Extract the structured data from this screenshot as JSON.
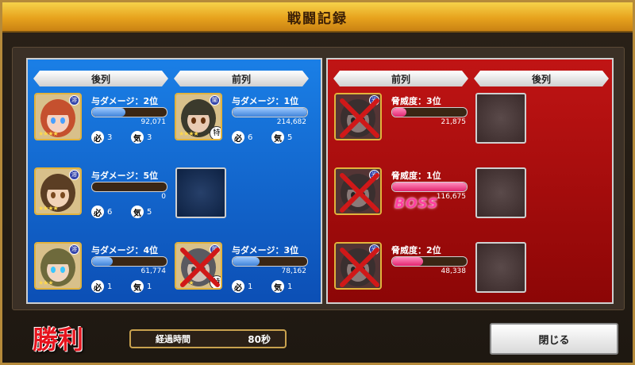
{
  "title": "戦闘記録",
  "ally": {
    "back_header": "後列",
    "front_header": "前列",
    "slots": [
      {
        "pos": "back-1",
        "label": "与ダメージ：2位",
        "value": "92,071",
        "fill": 0.45,
        "stat1_icon": "必",
        "stat1": "3",
        "stat2_icon": "気",
        "stat2": "3",
        "attr": "溶",
        "stars": "★★★★",
        "hair": "#c5502e",
        "skin": "#f6d2c0",
        "eye": "#4aa0ff"
      },
      {
        "pos": "front-1",
        "label": "与ダメージ：1位",
        "value": "214,682",
        "fill": 1.0,
        "stat1_icon": "必",
        "stat1": "6",
        "stat2_icon": "気",
        "stat2": "5",
        "attr": "闇",
        "stars": "★★★★",
        "hair": "#3b3a2c",
        "skin": "#e9cbb3",
        "eye": "#66330f",
        "token": "特"
      },
      {
        "pos": "back-2",
        "label": "与ダメージ：5位",
        "value": "0",
        "fill": 0.0,
        "stat1_icon": "必",
        "stat1": "6",
        "stat2_icon": "気",
        "stat2": "5",
        "attr": "溶",
        "stars": "★★★★",
        "hair": "#5b3e24",
        "skin": "#f2d3b7",
        "eye": "#7b4a1f"
      },
      {
        "pos": "back-3",
        "label": "与ダメージ：4位",
        "value": "61,774",
        "fill": 0.28,
        "stat1_icon": "必",
        "stat1": "1",
        "stat2_icon": "気",
        "stat2": "1",
        "attr": "溶",
        "stars": "★★★",
        "hair": "#6e6a3c",
        "skin": "#f0d6c1",
        "eye": "#39c6ff"
      },
      {
        "pos": "front-3",
        "label": "与ダメージ：3位",
        "value": "78,162",
        "fill": 0.36,
        "stat1_icon": "必",
        "stat1": "1",
        "stat2_icon": "気",
        "stat2": "1",
        "attr": "闇",
        "stars": "★★★",
        "hair": "#5a5a60",
        "skin": "#cfc0b5",
        "eye": "#444",
        "token": "特",
        "defeated": true
      }
    ]
  },
  "enemy": {
    "front_header": "前列",
    "back_header": "後列",
    "slots": [
      {
        "pos": "front-1",
        "label": "脅威度：3位",
        "value": "21,875",
        "fill": 0.19,
        "attr": "光",
        "defeated": true
      },
      {
        "pos": "front-2",
        "label": "脅威度：1位",
        "value": "116,675",
        "fill": 1.0,
        "attr": "光",
        "defeated": true,
        "boss": "BOSS"
      },
      {
        "pos": "front-3",
        "label": "脅威度：2位",
        "value": "48,338",
        "fill": 0.41,
        "attr": "光",
        "defeated": true
      }
    ]
  },
  "footer": {
    "result": "勝利",
    "elapsed_label": "経過時間",
    "elapsed_value": "80秒",
    "close_label": "閉じる"
  }
}
